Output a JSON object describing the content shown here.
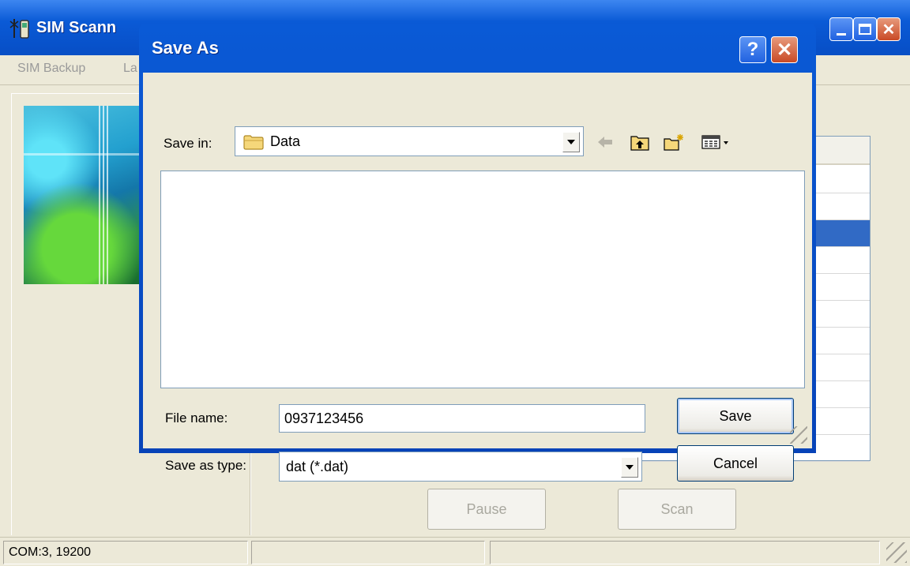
{
  "app": {
    "title": "SIM Scann",
    "menu": {
      "backup": "SIM Backup",
      "lang": "La"
    },
    "buttons": {
      "pause": "Pause",
      "scan": "Scan"
    },
    "status": {
      "port": "COM:3, 19200",
      "pane2": "",
      "pane3": ""
    }
  },
  "dialog": {
    "title": "Save As",
    "help_glyph": "?",
    "close_glyph": "✕",
    "save_in_label": "Save in:",
    "save_in_value": "Data",
    "file_name_label": "File name:",
    "file_name_value": "0937123456",
    "save_type_label": "Save as type:",
    "save_type_value": "dat (*.dat)",
    "save_label": "Save",
    "cancel_label": "Cancel"
  },
  "colors": {
    "titlebar": "#0a5ad6",
    "dialog_face": "#ece9d8",
    "selection": "#316ac5",
    "close_button": "#c94a26"
  },
  "icons": [
    "app-icon",
    "help-icon",
    "close-icon",
    "minimize-icon",
    "maximize-icon",
    "folder-icon",
    "chevron-down-icon",
    "back-arrow-icon",
    "up-folder-icon",
    "new-folder-icon",
    "views-menu-icon",
    "size-grip-icon"
  ]
}
